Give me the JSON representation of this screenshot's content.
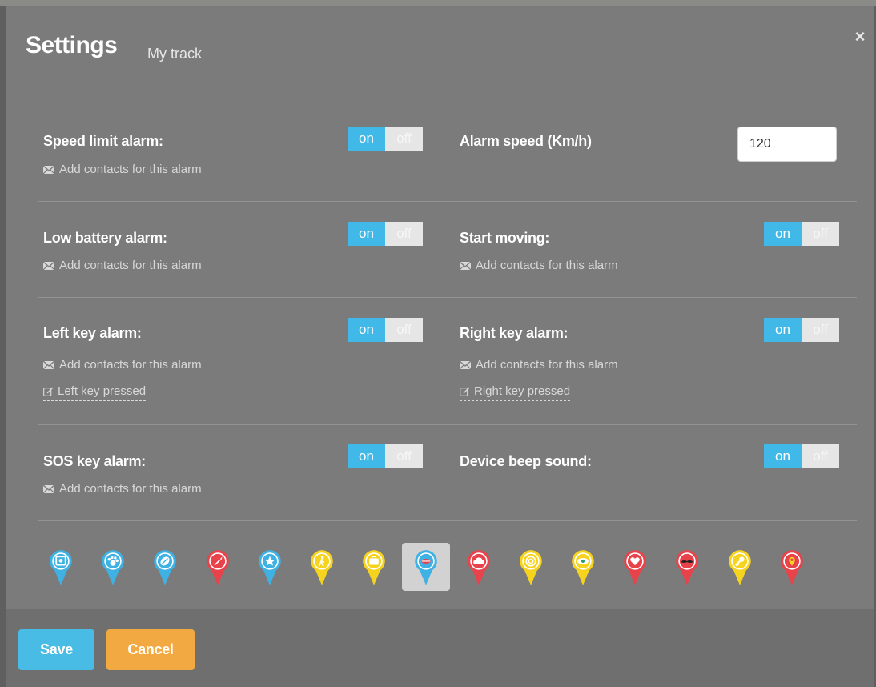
{
  "header": {
    "title": "Settings",
    "subtitle": "My track",
    "close_label": "×"
  },
  "toggle": {
    "on": "on",
    "off": "off"
  },
  "contacts_text": "Add contacts for this alarm",
  "alarms": {
    "speed_limit": {
      "label": "Speed limit alarm:",
      "state": "on"
    },
    "alarm_speed": {
      "label": "Alarm speed (Km/h)",
      "value": "120"
    },
    "low_battery": {
      "label": "Low battery alarm:",
      "state": "on"
    },
    "start_moving": {
      "label": "Start moving:",
      "state": "on"
    },
    "left_key": {
      "label": "Left key alarm:",
      "state": "on",
      "key_name": "Left key pressed"
    },
    "right_key": {
      "label": "Right key alarm:",
      "state": "on",
      "key_name": "Right key pressed"
    },
    "sos_key": {
      "label": "SOS key alarm:",
      "state": "on"
    },
    "beep": {
      "label": "Device beep sound:",
      "state": "on"
    }
  },
  "icons": [
    {
      "name": "photo-pin-icon",
      "color": "#3fb1e3",
      "symbol": "photo",
      "selected": false
    },
    {
      "name": "paw-pin-icon",
      "color": "#3fb1e3",
      "symbol": "paw",
      "selected": false
    },
    {
      "name": "ball-pin-icon",
      "color": "#3fb1e3",
      "symbol": "ball",
      "selected": false
    },
    {
      "name": "rocket-pin-icon",
      "color": "#e8434b",
      "symbol": "rocket",
      "selected": false
    },
    {
      "name": "star-pin-icon",
      "color": "#3fb1e3",
      "symbol": "star",
      "selected": false
    },
    {
      "name": "walker-pin-icon",
      "color": "#f5d31e",
      "symbol": "walker",
      "selected": false
    },
    {
      "name": "briefcase-pin-icon",
      "color": "#f5d31e",
      "symbol": "briefcase",
      "selected": false
    },
    {
      "name": "lips-pin-icon",
      "color": "#3fb1e3",
      "symbol": "lips",
      "selected": true
    },
    {
      "name": "cloud-pin-icon",
      "color": "#e8434b",
      "symbol": "cloud",
      "selected": false
    },
    {
      "name": "target-pin-icon",
      "color": "#f5d31e",
      "symbol": "target",
      "selected": false
    },
    {
      "name": "eye-pin-icon",
      "color": "#f5d31e",
      "symbol": "eye",
      "selected": false
    },
    {
      "name": "heart-pin-icon",
      "color": "#e8434b",
      "symbol": "heart",
      "selected": false
    },
    {
      "name": "mustache-pin-icon",
      "color": "#e8434b",
      "symbol": "mustache",
      "selected": false
    },
    {
      "name": "key-pin-icon",
      "color": "#f5d31e",
      "symbol": "key",
      "selected": false
    },
    {
      "name": "location-pin-icon",
      "color": "#e8434b",
      "symbol": "location",
      "selected": false
    }
  ],
  "footer": {
    "save_label": "Save",
    "cancel_label": "Cancel"
  },
  "colors": {
    "toggle_on": "#40b8e8",
    "save": "#49bce6",
    "cancel": "#f2a941"
  }
}
